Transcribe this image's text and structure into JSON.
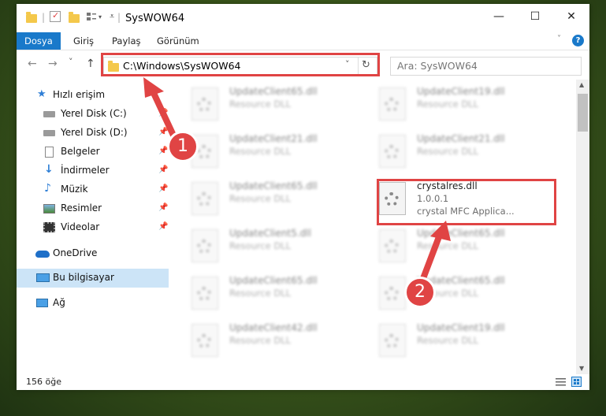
{
  "window": {
    "title": "SysWOW64",
    "minimize": "—",
    "maximize": "☐",
    "close": "✕"
  },
  "ribbon": {
    "tabs": [
      "Dosya",
      "Giriş",
      "Paylaş",
      "Görünüm"
    ],
    "help_icon": "?"
  },
  "nav": {
    "back": "←",
    "forward": "→",
    "recent": "˅",
    "up": "↑",
    "address": "C:\\Windows\\SysWOW64",
    "address_dropdown": "˅",
    "refresh": "↻",
    "search_placeholder": "Ara: SysWOW64"
  },
  "sidebar": {
    "items": [
      {
        "label": "Hızlı erişim",
        "icon": "star-icon"
      },
      {
        "label": "Yerel Disk (C:)",
        "icon": "drive-icon"
      },
      {
        "label": "Yerel Disk (D:)",
        "icon": "drive-icon"
      },
      {
        "label": "Belgeler",
        "icon": "documents-icon"
      },
      {
        "label": "İndirmeler",
        "icon": "download-icon"
      },
      {
        "label": "Müzik",
        "icon": "music-icon"
      },
      {
        "label": "Resimler",
        "icon": "pictures-icon"
      },
      {
        "label": "Videolar",
        "icon": "video-icon"
      },
      {
        "label": "OneDrive",
        "icon": "cloud-icon"
      },
      {
        "label": "Bu bilgisayar",
        "icon": "computer-icon"
      },
      {
        "label": "Ağ",
        "icon": "network-icon"
      }
    ]
  },
  "files": [
    {
      "name": "UpdateClient65.dll",
      "line1": "Resource DLL",
      "line2": ""
    },
    {
      "name": "UpdateClient19.dll",
      "line1": "Resource DLL",
      "line2": ""
    },
    {
      "name": "UpdateClient21.dll",
      "line1": "Resource DLL",
      "line2": ""
    },
    {
      "name": "UpdateClient21.dll",
      "line1": "Resource DLL",
      "line2": ""
    },
    {
      "name": "UpdateClient65.dll",
      "line1": "Resource DLL",
      "line2": ""
    },
    {
      "name": "crystalres.dll",
      "line1": "1.0.0.1",
      "line2": "crystal MFC Applica..."
    },
    {
      "name": "UpdateClient5.dll",
      "line1": "Resource DLL",
      "line2": ""
    },
    {
      "name": "UpdateClient65.dll",
      "line1": "Resource DLL",
      "line2": ""
    },
    {
      "name": "UpdateClient65.dll",
      "line1": "Resource DLL",
      "line2": ""
    },
    {
      "name": "UpdateClient65.dll",
      "line1": "Resource DLL",
      "line2": ""
    },
    {
      "name": "UpdateClient42.dll",
      "line1": "Resource DLL",
      "line2": ""
    },
    {
      "name": "UpdateClient19.dll",
      "line1": "Resource DLL",
      "line2": ""
    }
  ],
  "status": {
    "count": "156 öğe"
  },
  "annotations": {
    "step1": "1",
    "step2": "2",
    "accent_color": "#e04444"
  }
}
